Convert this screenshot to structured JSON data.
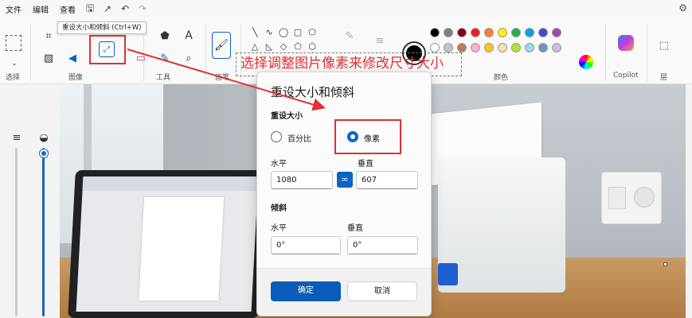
{
  "menubar": {
    "file": "文件",
    "edit": "编辑",
    "view": "查看"
  },
  "tooltip": "重设大小和倾斜 (Ctrl+W)",
  "ribbon": {
    "groups": {
      "select": "选择",
      "image": "图像",
      "tools": "工具",
      "brushes": "画笔",
      "colors": "颜色",
      "copilot": "Copilot",
      "layers": "层"
    },
    "text_tool": "A",
    "palette": [
      "#000000",
      "#7f7f7f",
      "#880015",
      "#ed1c24",
      "#ff7f27",
      "#fff200",
      "#22b14c",
      "#00a2e8",
      "#3f48cc",
      "#a349a4",
      "#ffffff",
      "#c3c3c3",
      "#b97a57",
      "#ffaec9",
      "#ffc90e",
      "#efe4b0",
      "#b5e61d",
      "#99d9ea",
      "#7092be",
      "#c8bfe7"
    ],
    "current_color": "#000000"
  },
  "annotation": "选择调整图片像素来修改尺寸大小",
  "dialog": {
    "title": "重设大小和倾斜",
    "resize_section": "重设大小",
    "radio_percent": "百分比",
    "radio_pixels": "像素",
    "horizontal_label": "水平",
    "vertical_label": "垂直",
    "horizontal_value": "1080",
    "vertical_value": "607",
    "skew_section": "倾斜",
    "skew_horizontal_label": "水平",
    "skew_vertical_label": "垂直",
    "skew_horizontal_value": "0°",
    "skew_vertical_value": "0°",
    "ok": "确定",
    "cancel": "取消"
  },
  "accent": "#0b63c4",
  "highlight": "#e03131"
}
